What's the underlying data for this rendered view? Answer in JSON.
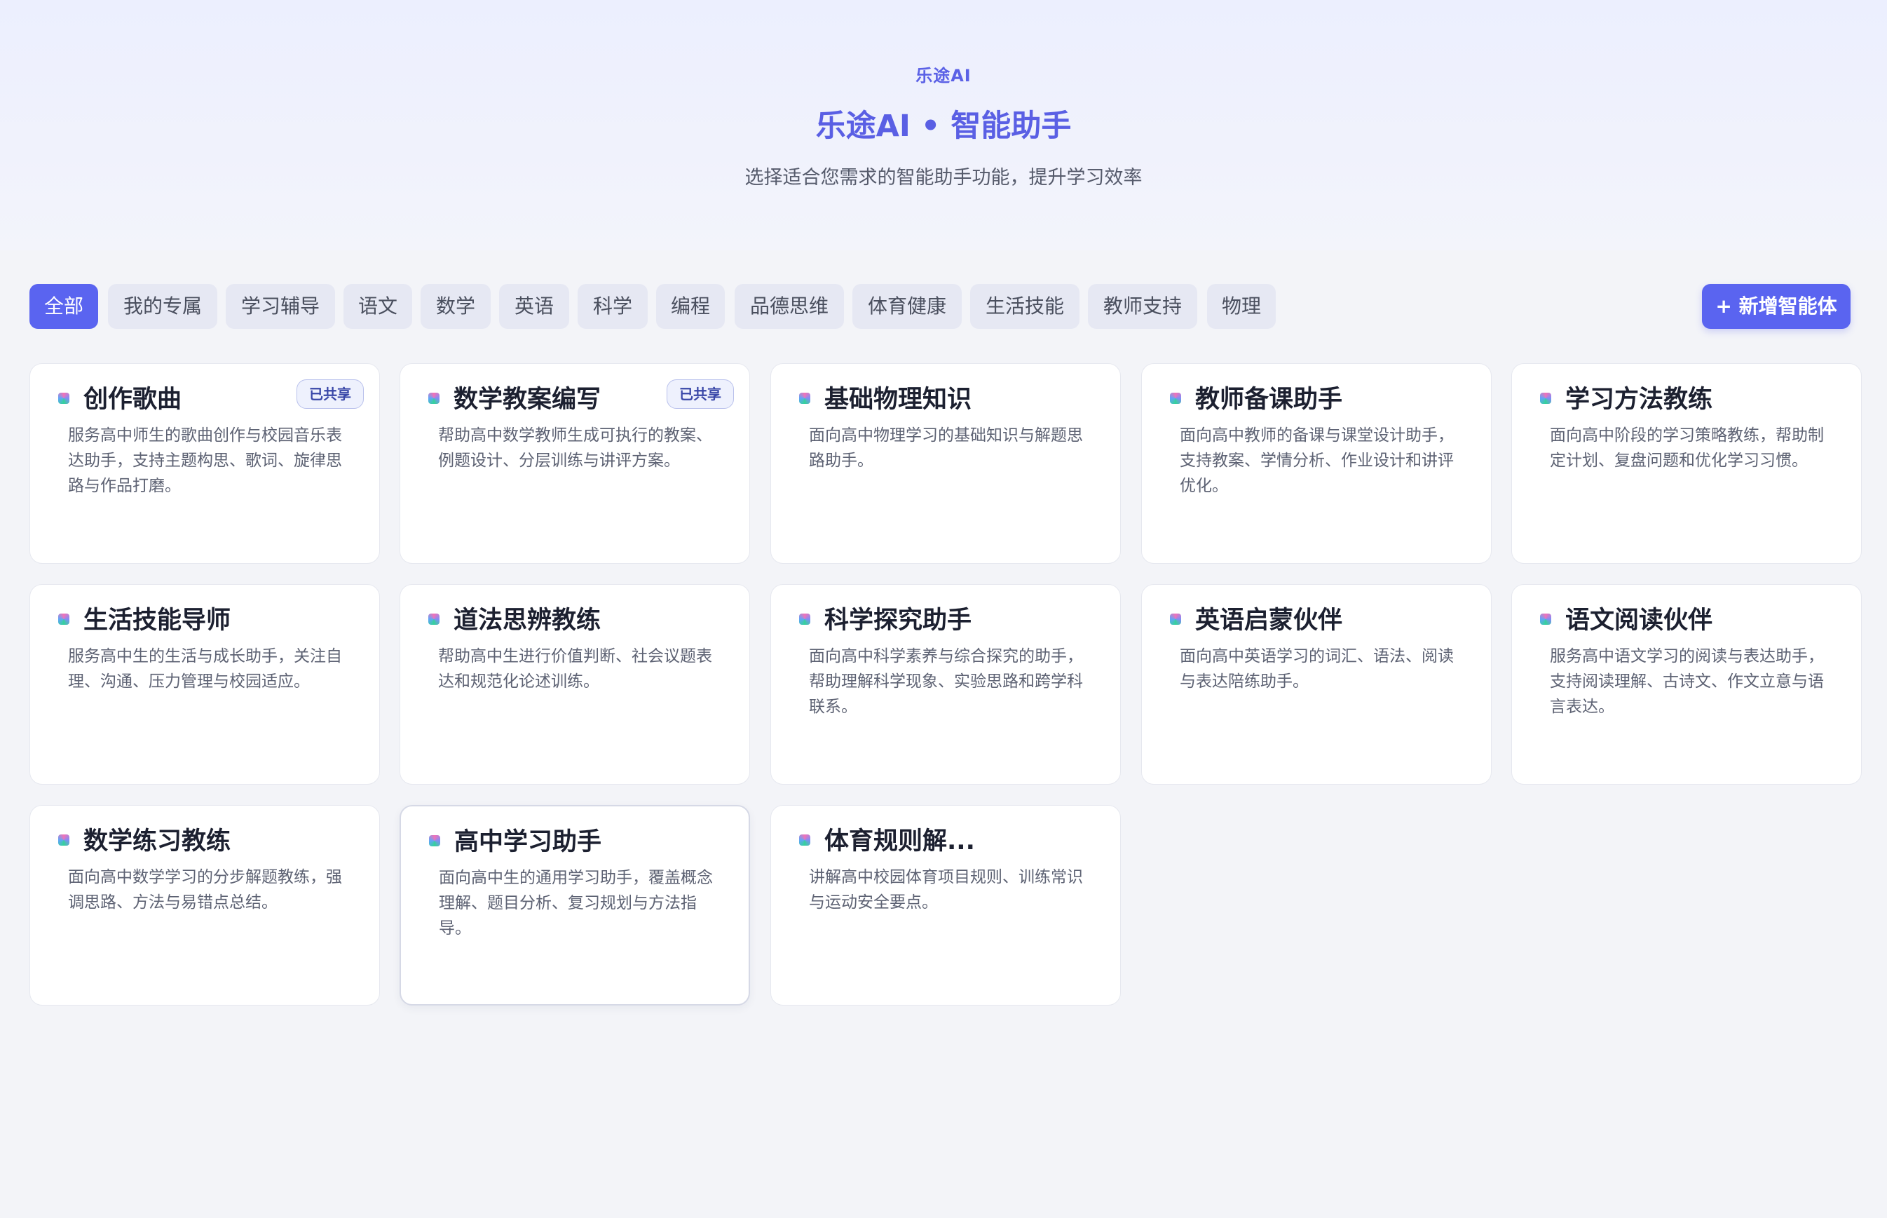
{
  "header": {
    "brand": "乐途AI",
    "title": "乐途AI • 智能助手",
    "subtitle": "选择适合您需求的智能助手功能，提升学习效率"
  },
  "filters": {
    "tabs": [
      "全部",
      "我的专属",
      "学习辅导",
      "语文",
      "数学",
      "英语",
      "科学",
      "编程",
      "品德思维",
      "体育健康",
      "生活技能",
      "教师支持",
      "物理"
    ],
    "active": "全部",
    "add_button": "+ 新增智能体"
  },
  "cards": [
    {
      "name": "创作歌曲",
      "desc": "服务高中师生的歌曲创作与校园音乐表达助手，支持主题构思、歌词、旋律思路与作品打磨。",
      "badge": "已共享"
    },
    {
      "name": "数学教案编写",
      "desc": "帮助高中数学教师生成可执行的教案、例题设计、分层训练与讲评方案。",
      "badge": "已共享"
    },
    {
      "name": "基础物理知识",
      "desc": "面向高中物理学习的基础知识与解题思路助手。",
      "badge": ""
    },
    {
      "name": "教师备课助手",
      "desc": "面向高中教师的备课与课堂设计助手，支持教案、学情分析、作业设计和讲评优化。",
      "badge": ""
    },
    {
      "name": "学习方法教练",
      "desc": "面向高中阶段的学习策略教练，帮助制定计划、复盘问题和优化学习习惯。",
      "badge": ""
    },
    {
      "name": "生活技能导师",
      "desc": "服务高中生的生活与成长助手，关注自理、沟通、压力管理与校园适应。",
      "badge": ""
    },
    {
      "name": "道法思辨教练",
      "desc": "帮助高中生进行价值判断、社会议题表达和规范化论述训练。",
      "badge": ""
    },
    {
      "name": "科学探究助手",
      "desc": "面向高中科学素养与综合探究的助手，帮助理解科学现象、实验思路和跨学科联系。",
      "badge": ""
    },
    {
      "name": "英语启蒙伙伴",
      "desc": "面向高中英语学习的词汇、语法、阅读与表达陪练助手。",
      "badge": ""
    },
    {
      "name": "语文阅读伙伴",
      "desc": "服务高中语文学习的阅读与表达助手，支持阅读理解、古诗文、作文立意与语言表达。",
      "badge": ""
    },
    {
      "name": "数学练习教练",
      "desc": "面向高中数学学习的分步解题教练，强调思路、方法与易错点总结。",
      "badge": ""
    },
    {
      "name": "高中学习助手",
      "desc": "面向高中生的通用学习助手，覆盖概念理解、题目分析、复习规划与方法指导。",
      "badge": ""
    },
    {
      "name": "体育规则解...",
      "desc": "讲解高中校园体育项目规则、训练常识与运动安全要点。",
      "badge": ""
    }
  ]
}
